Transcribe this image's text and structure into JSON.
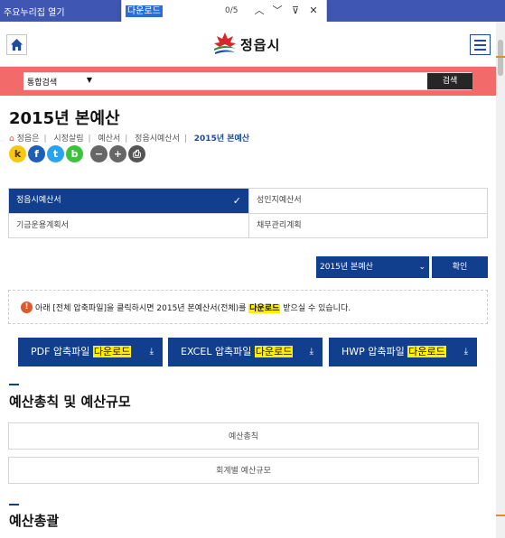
{
  "quickbar": {
    "label": "주요누리집 열기",
    "close": "✕"
  },
  "findbar": {
    "term": "다운로드",
    "count": "0/5",
    "prev": "︿",
    "next": "﹀",
    "filter": "⊽",
    "close": "✕"
  },
  "header": {
    "logo_text": "정읍시",
    "home_icon": "home-icon",
    "menu_icon": "hamburger-menu-icon"
  },
  "search": {
    "scope": "통합검색",
    "button": "검색"
  },
  "page": {
    "title": "2015년 본예산"
  },
  "breadcrumb": {
    "items": [
      "정읍은",
      "시정살림",
      "예산서",
      "정읍시예산서"
    ],
    "current": "2015년 본예산"
  },
  "share": {
    "kakaostory": "k",
    "facebook": "f",
    "twitter": "t",
    "band": "b",
    "zoom_out": "−",
    "zoom_in": "+",
    "print": "⎙"
  },
  "tabs": [
    {
      "label": "정읍시예산서",
      "active": true
    },
    {
      "label": "성인지예산서",
      "active": false
    },
    {
      "label": "기금운용계획서",
      "active": false
    },
    {
      "label": "채무관리계획",
      "active": false
    }
  ],
  "year": {
    "selected": "2015년 본예산",
    "confirm": "확인"
  },
  "notice": {
    "icon": "!",
    "before": "아래 [전체 압축파일]을 클릭하시면 2015년 본예산서(전체)를 ",
    "highlight": "다운로드",
    "after": " 받으실 수 있습니다."
  },
  "downloads": [
    {
      "prefix": "PDF 압축파일 ",
      "highlight": "다운로드"
    },
    {
      "prefix": "EXCEL 압축파일 ",
      "highlight": "다운로드"
    },
    {
      "prefix": "HWP 압축파일 ",
      "highlight": "다운로드"
    }
  ],
  "sections": {
    "scale_title": "예산총칙 및 예산규모",
    "scale_links": [
      "예산총칙",
      "회계별 예산규모"
    ],
    "summary_title": "예산총괄"
  },
  "colors": {
    "primary": "#123e8e",
    "search_strip": "#f26a6a",
    "highlight": "#ffee00",
    "quickbar": "#3f57b2"
  }
}
